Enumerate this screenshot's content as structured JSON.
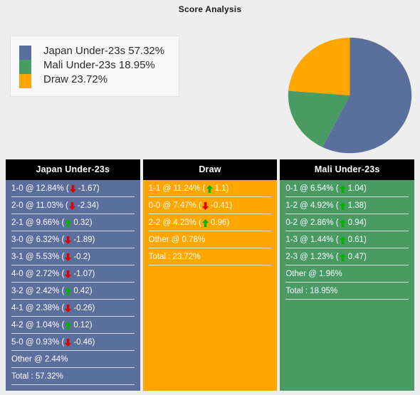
{
  "title": "Score Analysis",
  "colors": {
    "background": "#eeeeee",
    "japan": "#5b6f9c",
    "mali": "#499b63",
    "draw": "#ffa700",
    "header": "#000000",
    "up_arrow": "#00b300",
    "down_arrow": "#e00000"
  },
  "legend": {
    "items": [
      {
        "label": "Japan Under-23s 57.32%",
        "color": "#5b6f9c",
        "icon": "legend-swatch-blue"
      },
      {
        "label": "Mali Under-23s 18.95%",
        "color": "#499b63",
        "icon": "legend-swatch-green"
      },
      {
        "label": "Draw 23.72%",
        "color": "#ffa700",
        "icon": "legend-swatch-orange"
      }
    ]
  },
  "chart_data": {
    "type": "pie",
    "title": "Score Analysis",
    "labels": [
      "Japan Under-23s",
      "Mali Under-23s",
      "Draw"
    ],
    "values": [
      57.32,
      18.95,
      23.72
    ],
    "colors": [
      "#5b6f9c",
      "#499b63",
      "#ffa700"
    ],
    "unit": "%",
    "start_angle": 0,
    "direction": "clockwise",
    "legend_position": "left",
    "grid": false
  },
  "table": {
    "columns": [
      {
        "key": "japan",
        "header": "Japan Under-23s",
        "header_name": "column-header-japan",
        "rows": [
          {
            "score": "1-0",
            "pct": "12.84%",
            "delta": "-1.67",
            "dir": "down",
            "text": "1-0 @ 12.84% (",
            "suffix": "-1.67)"
          },
          {
            "score": "2-0",
            "pct": "11.03%",
            "delta": "-2.34",
            "dir": "down",
            "text": "2-0 @ 11.03% (",
            "suffix": "-2.34)"
          },
          {
            "score": "2-1",
            "pct": "9.66%",
            "delta": "0.32",
            "dir": "up",
            "text": "2-1 @ 9.66% (",
            "suffix": "0.32)"
          },
          {
            "score": "3-0",
            "pct": "6.32%",
            "delta": "-1.89",
            "dir": "down",
            "text": "3-0 @ 6.32% (",
            "suffix": "-1.89)"
          },
          {
            "score": "3-1",
            "pct": "5.53%",
            "delta": "-0.2",
            "dir": "down",
            "text": "3-1 @ 5.53% (",
            "suffix": "-0.2)"
          },
          {
            "score": "4-0",
            "pct": "2.72%",
            "delta": "-1.07",
            "dir": "down",
            "text": "4-0 @ 2.72% (",
            "suffix": "-1.07)"
          },
          {
            "score": "3-2",
            "pct": "2.42%",
            "delta": "0.42",
            "dir": "up",
            "text": "3-2 @ 2.42% (",
            "suffix": "0.42)"
          },
          {
            "score": "4-1",
            "pct": "2.38%",
            "delta": "-0.26",
            "dir": "down",
            "text": "4-1 @ 2.38% (",
            "suffix": "-0.26)"
          },
          {
            "score": "4-2",
            "pct": "1.04%",
            "delta": "0.12",
            "dir": "up",
            "text": "4-2 @ 1.04% (",
            "suffix": "0.12)"
          },
          {
            "score": "5-0",
            "pct": "0.93%",
            "delta": "-0.46",
            "dir": "down",
            "text": "5-0 @ 0.93% (",
            "suffix": "-0.46)"
          },
          {
            "score": "Other",
            "pct": "2.44%",
            "delta": null,
            "dir": "none",
            "text": "Other @ 2.44%",
            "suffix": ""
          },
          {
            "score": "Total",
            "pct": "57.32%",
            "delta": null,
            "dir": "none",
            "text": "Total : 57.32%",
            "suffix": ""
          }
        ]
      },
      {
        "key": "draw",
        "header": "Draw",
        "header_name": "column-header-draw",
        "rows": [
          {
            "score": "1-1",
            "pct": "11.24%",
            "delta": "1.1",
            "dir": "up",
            "text": "1-1 @ 11.24% (",
            "suffix": "1.1)"
          },
          {
            "score": "0-0",
            "pct": "7.47%",
            "delta": "-0.41",
            "dir": "down",
            "text": "0-0 @ 7.47% (",
            "suffix": "-0.41)"
          },
          {
            "score": "2-2",
            "pct": "4.23%",
            "delta": "0.96",
            "dir": "up",
            "text": "2-2 @ 4.23% (",
            "suffix": "0.96)"
          },
          {
            "score": "Other",
            "pct": "0.78%",
            "delta": null,
            "dir": "none",
            "text": "Other @ 0.78%",
            "suffix": ""
          },
          {
            "score": "Total",
            "pct": "23.72%",
            "delta": null,
            "dir": "none",
            "text": "Total : 23.72%",
            "suffix": ""
          }
        ]
      },
      {
        "key": "mali",
        "header": "Mali Under-23s",
        "header_name": "column-header-mali",
        "rows": [
          {
            "score": "0-1",
            "pct": "6.54%",
            "delta": "1.04",
            "dir": "up",
            "text": "0-1 @ 6.54% (",
            "suffix": "1.04)"
          },
          {
            "score": "1-2",
            "pct": "4.92%",
            "delta": "1.38",
            "dir": "up",
            "text": "1-2 @ 4.92% (",
            "suffix": "1.38)"
          },
          {
            "score": "0-2",
            "pct": "2.86%",
            "delta": "0.94",
            "dir": "up",
            "text": "0-2 @ 2.86% (",
            "suffix": "0.94)"
          },
          {
            "score": "1-3",
            "pct": "1.44%",
            "delta": "0.61",
            "dir": "up",
            "text": "1-3 @ 1.44% (",
            "suffix": "0.61)"
          },
          {
            "score": "2-3",
            "pct": "1.23%",
            "delta": "0.47",
            "dir": "up",
            "text": "2-3 @ 1.23% (",
            "suffix": "0.47)"
          },
          {
            "score": "Other",
            "pct": "1.96%",
            "delta": null,
            "dir": "none",
            "text": "Other @ 1.96%",
            "suffix": ""
          },
          {
            "score": "Total",
            "pct": "18.95%",
            "delta": null,
            "dir": "none",
            "text": "Total : 18.95%",
            "suffix": ""
          }
        ]
      }
    ]
  }
}
